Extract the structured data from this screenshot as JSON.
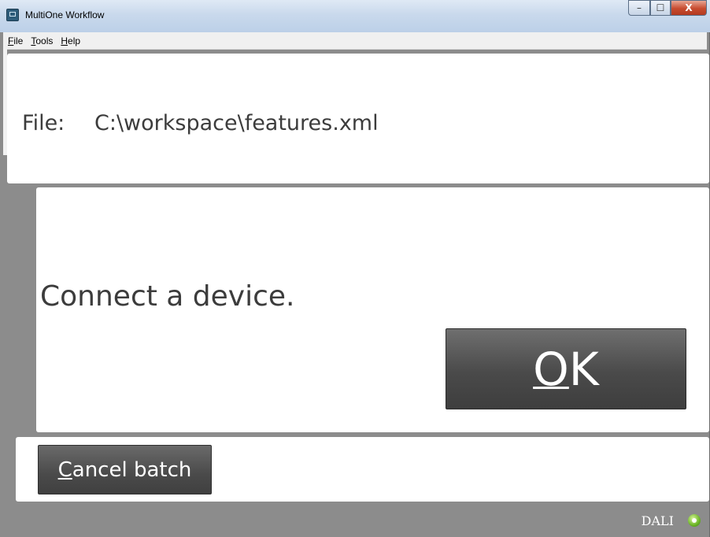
{
  "window": {
    "title": "MultiOne Workflow",
    "controls": {
      "minimize": "–",
      "maximize": "☐",
      "close": "X"
    }
  },
  "menu": {
    "items": [
      {
        "mnemonic": "F",
        "rest": "ile"
      },
      {
        "mnemonic": "T",
        "rest": "ools"
      },
      {
        "mnemonic": "H",
        "rest": "elp"
      }
    ]
  },
  "file_panel": {
    "label": "File:",
    "path": "C:\\workspace\\features.xml"
  },
  "message_panel": {
    "message": "Connect a device.",
    "ok_mnemonic": "O",
    "ok_rest": "K"
  },
  "bottom_panel": {
    "cancel_mnemonic": "C",
    "cancel_rest": "ancel batch"
  },
  "status_bar": {
    "interface": "DALI",
    "status_icon": "green-connection-status-icon"
  },
  "colors": {
    "background": "#8c8c8c",
    "panel": "#ffffff",
    "button": "#4a4a4a",
    "text": "#3c3c3c",
    "status_ok": "#6bb526"
  }
}
